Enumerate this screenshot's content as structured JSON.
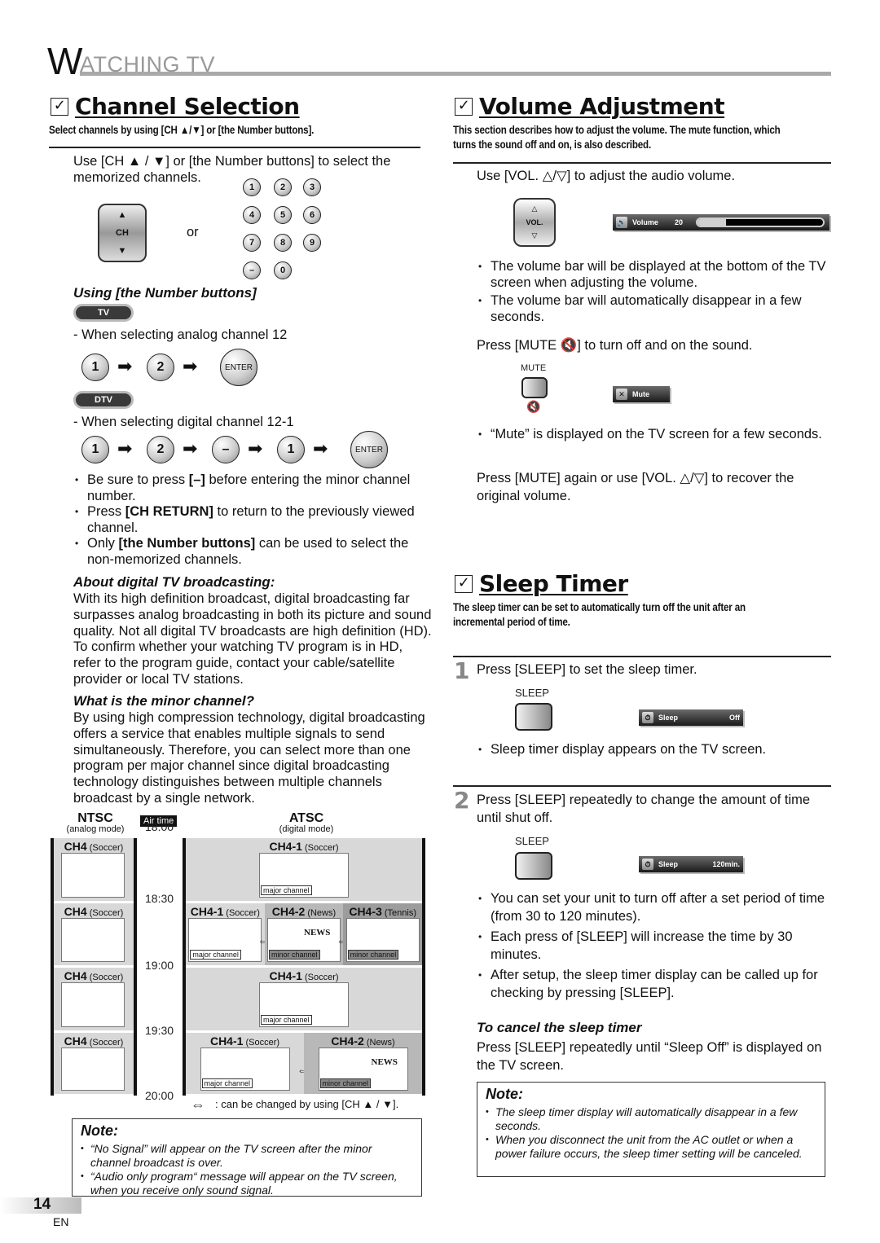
{
  "header": {
    "first_letter": "W",
    "rest": "ATCHING TV"
  },
  "channel_selection": {
    "title": "Channel Selection",
    "subtitle": "Select channels by using [CH ▲/▼] or [the Number buttons].",
    "intro_line1": "Use [CH ▲ / ▼] or [the Number buttons] to select the",
    "intro_line2": "memorized channels.",
    "ch_button": {
      "up": "▲",
      "label": "CH",
      "down": "▼"
    },
    "or_label": "or",
    "keypad": [
      "1",
      "2",
      "3",
      "4",
      "5",
      "6",
      "7",
      "8",
      "9",
      "–",
      "0"
    ],
    "using_number_heading": "Using [the Number buttons]",
    "tv_pill": "TV",
    "analog_example": "-  When selecting analog channel 12",
    "analog_sequence": [
      "1",
      "2",
      "ENTER"
    ],
    "dtv_pill": "DTV",
    "digital_example": "-  When selecting digital channel 12-1",
    "digital_sequence": [
      "1",
      "2",
      "–",
      "1",
      "ENTER"
    ],
    "bullets": [
      {
        "pre": "Be sure to press ",
        "bold": "[–]",
        "post": " before entering the minor channel number."
      },
      {
        "pre": "Press ",
        "bold": "[CH RETURN]",
        "post": " to return to the previously viewed channel."
      },
      {
        "pre": "Only ",
        "bold": "[the Number buttons]",
        "post": " can be used to select the non-memorized channels."
      }
    ],
    "about_heading": "About digital TV broadcasting:",
    "about_text": "With its high definition broadcast, digital broadcasting far surpasses analog broadcasting in both its picture and sound quality. Not all digital TV broadcasts are high definition (HD). To confirm whether your watching TV program is in HD, refer to the program guide, contact your cable/satellite provider or local TV stations.",
    "minor_heading": "What is the minor channel?",
    "minor_text": "By using high compression technology, digital broadcasting offers a service that enables multiple signals to send simultaneously. Therefore, you can select more than one program per major channel since digital broadcasting technology distinguishes between multiple channels broadcast by a single network.",
    "diagram": {
      "ntsc_title": "NTSC",
      "ntsc_sub": "(analog mode)",
      "air_time": "Air time",
      "atsc_title": "ATSC",
      "atsc_sub": "(digital mode)",
      "times": [
        "18:00",
        "18:30",
        "19:00",
        "19:30",
        "20:00"
      ],
      "ntsc_rows": [
        {
          "ch": "CH4",
          "prog": "(Soccer)"
        },
        {
          "ch": "CH4",
          "prog": "(Soccer)"
        },
        {
          "ch": "CH4",
          "prog": "(Soccer)"
        },
        {
          "ch": "CH4",
          "prog": "(Soccer)"
        }
      ],
      "atsc_rows": [
        [
          {
            "ch": "CH4-1",
            "prog": "(Soccer)",
            "tag": "major channel"
          }
        ],
        [
          {
            "ch": "CH4-1",
            "prog": "(Soccer)",
            "tag": "major channel"
          },
          {
            "ch": "CH4-2",
            "prog": "(News)",
            "tag": "minor channel"
          },
          {
            "ch": "CH4-3",
            "prog": "(Tennis)",
            "tag": "minor channel"
          }
        ],
        [
          {
            "ch": "CH4-1",
            "prog": "(Soccer)",
            "tag": "major channel"
          }
        ],
        [
          {
            "ch": "CH4-1",
            "prog": "(Soccer)",
            "tag": "major channel"
          },
          {
            "ch": "CH4-2",
            "prog": "(News)",
            "tag": "minor channel"
          }
        ]
      ],
      "news_label": "NEWS",
      "legend": ": can be changed by using [CH ▲ / ▼]."
    },
    "note": {
      "heading": "Note:",
      "items": [
        "“No Signal” will appear on the TV screen after the minor channel broadcast is over.",
        "“Audio only program“ message will appear on the TV screen, when you receive only sound signal."
      ]
    }
  },
  "volume": {
    "title": "Volume Adjustment",
    "subtitle_line1": "This section describes how to adjust the volume. The mute function, which",
    "subtitle_line2": "turns the sound off and on, is also described.",
    "instruction": "Use [VOL. △/▽] to adjust the audio volume.",
    "vol_button": {
      "up": "△",
      "label": "VOL.",
      "down": "▽"
    },
    "osd": {
      "label": "Volume",
      "value": "20",
      "level_fraction": 0.23
    },
    "bullets": [
      "The volume bar will be displayed at the bottom of the TV screen when adjusting the volume.",
      "The volume bar will automatically disappear in a few seconds."
    ],
    "mute_instruction": "Press [MUTE 🔇] to turn off and on the sound.",
    "mute_button_label": "MUTE",
    "mute_osd": "Mute",
    "mute_bullet": "“Mute” is displayed on the TV screen for a few seconds.",
    "recover_text": "Press [MUTE] again or use [VOL. △/▽] to recover the original volume."
  },
  "sleep": {
    "title": "Sleep Timer",
    "subtitle_line1": "The sleep timer can be set to automatically turn off the unit after an",
    "subtitle_line2": "incremental period of time.",
    "step1": {
      "num": "1",
      "text": "Press [SLEEP] to set the sleep timer.",
      "button_label": "SLEEP",
      "osd_label": "Sleep",
      "osd_value": "Off",
      "bullet": "Sleep timer display appears on the TV screen."
    },
    "step2": {
      "num": "2",
      "text": "Press [SLEEP] repeatedly to change the amount of time until shut off.",
      "button_label": "SLEEP",
      "osd_label": "Sleep",
      "osd_value": "120min.",
      "bullets": [
        "You can set your unit to turn off after a set period of time (from 30 to 120 minutes).",
        "Each press of [SLEEP] will increase the time by 30 minutes.",
        "After setup, the sleep timer display can be called up for checking by pressing [SLEEP]."
      ]
    },
    "cancel_heading": "To cancel the sleep timer",
    "cancel_text": "Press [SLEEP] repeatedly until “Sleep Off” is displayed on the TV screen.",
    "note": {
      "heading": "Note:",
      "items": [
        "The sleep timer display will automatically disappear in a few seconds.",
        "When you disconnect the unit from the AC outlet or when a power failure occurs, the sleep timer setting will be canceled."
      ]
    }
  },
  "footer": {
    "page": "14",
    "lang": "EN"
  }
}
